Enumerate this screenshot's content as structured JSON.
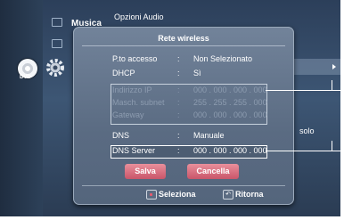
{
  "background": {
    "menu_title": "Musica",
    "panel_title": "Opzioni Audio",
    "disc_label": "DVD",
    "right_item": "solo"
  },
  "dialog": {
    "title": "Rete wireless",
    "rows": [
      {
        "label": "P.to accesso",
        "sep": ":",
        "value": "Non Selezionato",
        "enabled": true
      },
      {
        "label": "DHCP",
        "sep": ":",
        "value": "Sì",
        "enabled": true
      },
      {
        "label": "Indirizzo IP",
        "sep": ":",
        "value": "000 . 000 . 000 . 000",
        "enabled": false
      },
      {
        "label": "Masch. subnet",
        "sep": ":",
        "value": "255 . 255 . 255 . 000",
        "enabled": false
      },
      {
        "label": "Gateway",
        "sep": ":",
        "value": "000 . 000 . 000 . 000",
        "enabled": false
      },
      {
        "label": "DNS",
        "sep": ":",
        "value": "Manuale",
        "enabled": true
      },
      {
        "label": "DNS Server",
        "sep": ":",
        "value": "000 . 000 . 000 . 000",
        "enabled": true,
        "selected": true
      }
    ],
    "save_label": "Salva",
    "cancel_label": "Cancella",
    "hint_select": "Seleziona",
    "hint_return": "Ritorna"
  },
  "colors": {
    "button_accent": "#c9566a",
    "dialog_bg": "#5f7088"
  }
}
